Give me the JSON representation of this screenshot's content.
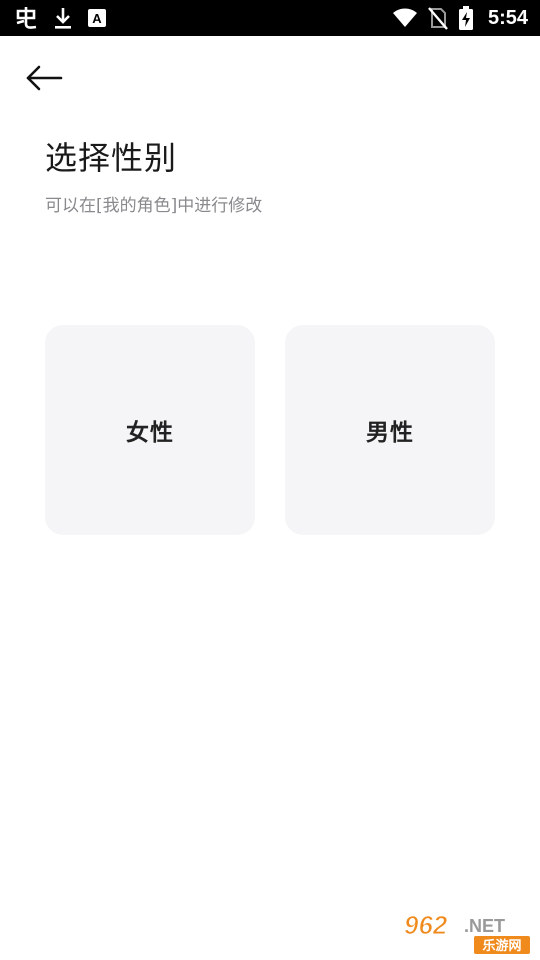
{
  "status_bar": {
    "time": "5:54",
    "icons": [
      "app-notification-icon",
      "download-icon",
      "a-box-icon",
      "wifi-icon",
      "no-sim-icon",
      "battery-charging-icon"
    ]
  },
  "header": {
    "back_icon": "arrow-left-icon"
  },
  "main": {
    "title": "选择性别",
    "subtitle": "可以在[我的角色]中进行修改",
    "options": [
      {
        "label": "女性"
      },
      {
        "label": "男性"
      }
    ]
  },
  "watermark": {
    "text_main": "962.NET",
    "text_sub": "乐游网"
  },
  "colors": {
    "status_bar_bg": "#000000",
    "background": "#ffffff",
    "card_bg": "#f5f5f7",
    "title": "#1a1a1a",
    "subtitle": "#8a8a8e",
    "watermark_orange": "#f08a1c"
  }
}
